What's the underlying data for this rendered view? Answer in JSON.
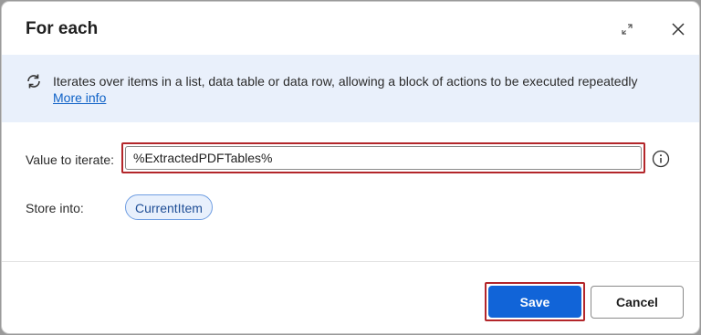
{
  "dialog": {
    "title": "For each",
    "expand_icon": "expand-icon",
    "close_icon": "close-icon"
  },
  "banner": {
    "icon": "loop-icon",
    "text": "Iterates over items in a list, data table or data row, allowing a block of actions to be executed repeatedly",
    "link": "More info"
  },
  "form": {
    "value_label": "Value to iterate:",
    "value": "%ExtractedPDFTables%",
    "value_info_icon": "info-icon",
    "store_label": "Store into:",
    "store_variable": "CurrentItem"
  },
  "footer": {
    "save_label": "Save",
    "cancel_label": "Cancel"
  },
  "colors": {
    "accent": "#1164d8",
    "highlight_border": "#b3262a",
    "banner_bg": "#e9f0fb",
    "link": "#0f62c7"
  }
}
